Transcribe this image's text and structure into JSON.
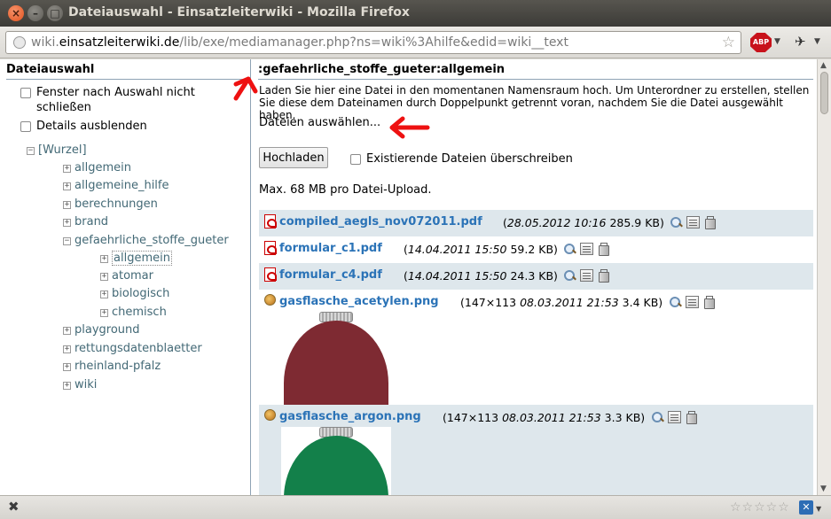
{
  "window": {
    "title": "Dateiauswahl - Einsatzleiterwiki - Mozilla Firefox",
    "close_glyph": "×",
    "min_glyph": "–",
    "max_glyph": "□"
  },
  "toolbar": {
    "url_prefix": "wiki.",
    "url_domain": "einsatzleiterwiki.de",
    "url_path": "/lib/exe/mediamanager.php?ns=wiki%3Ahilfe&edid=wiki__text",
    "bookmark_glyph": "☆",
    "adblock_label": "ABP",
    "dropdown_glyph": "▼",
    "addon_glyph": "✈"
  },
  "sidebar": {
    "heading": "Dateiauswahl",
    "options": [
      {
        "label": "Fenster nach Auswahl nicht schließen",
        "checked": false
      },
      {
        "label": "Details ausblenden",
        "checked": false
      }
    ],
    "tree": {
      "root": "[Wurzel]",
      "collapse_glyph": "−",
      "expand_glyph": "+",
      "items": [
        {
          "label": "allgemein"
        },
        {
          "label": "allgemeine_hilfe"
        },
        {
          "label": "berechnungen"
        },
        {
          "label": "brand"
        },
        {
          "label": "gefaehrliche_stoffe_gueter",
          "open": true
        },
        {
          "label": "allgemein",
          "selected": true
        },
        {
          "label": "atomar"
        },
        {
          "label": "biologisch"
        },
        {
          "label": "chemisch"
        },
        {
          "label": "playground"
        },
        {
          "label": "rettungsdatenblaetter"
        },
        {
          "label": "rheinland-pfalz"
        },
        {
          "label": "wiki"
        }
      ]
    }
  },
  "main": {
    "namespace_heading": ":gefaehrliche_stoffe_gueter:allgemein",
    "upload_description": "Laden Sie hier eine Datei in den momentanen Namensraum hoch. Um Unterordner zu erstellen, stellen Sie diese dem Dateinamen durch Doppelpunkt getrennt voran, nachdem Sie die Datei ausgewählt haben.",
    "choose_files": "Dateien auswählen...",
    "upload_button": "Hochladen",
    "overwrite_label": "Existierende Dateien überschreiben",
    "max_upload": "Max. 68 MB pro Datei-Upload.",
    "files": [
      {
        "name": "compiled_aegls_nov072011.pdf",
        "dims": "",
        "date": "28.05.2012 10:16",
        "size": "285.9 KB",
        "type": "pdf",
        "alt": true
      },
      {
        "name": "formular_c1.pdf",
        "dims": "",
        "date": "14.04.2011 15:50",
        "size": "59.2 KB",
        "type": "pdf",
        "alt": false
      },
      {
        "name": "formular_c4.pdf",
        "dims": "",
        "date": "14.04.2011 15:50",
        "size": "24.3 KB",
        "type": "pdf",
        "alt": true
      },
      {
        "name": "gasflasche_acetylen.png",
        "dims": "147×113",
        "date": "08.03.2011 21:53",
        "size": "3.4 KB",
        "type": "image",
        "alt": false,
        "thumb_color": "#7e2a32"
      },
      {
        "name": "gasflasche_argon.png",
        "dims": "147×113",
        "date": "08.03.2011 21:53",
        "size": "3.3 KB",
        "type": "image",
        "alt": true,
        "thumb_color": "#13804a"
      }
    ]
  },
  "annotations": {
    "arrow_color": "#ee1111"
  },
  "statusbar": {
    "close_glyph": "✖",
    "rating_glyphs": "☆☆☆☆☆",
    "addon_x": "✕",
    "dropdown_glyph": "▼"
  }
}
